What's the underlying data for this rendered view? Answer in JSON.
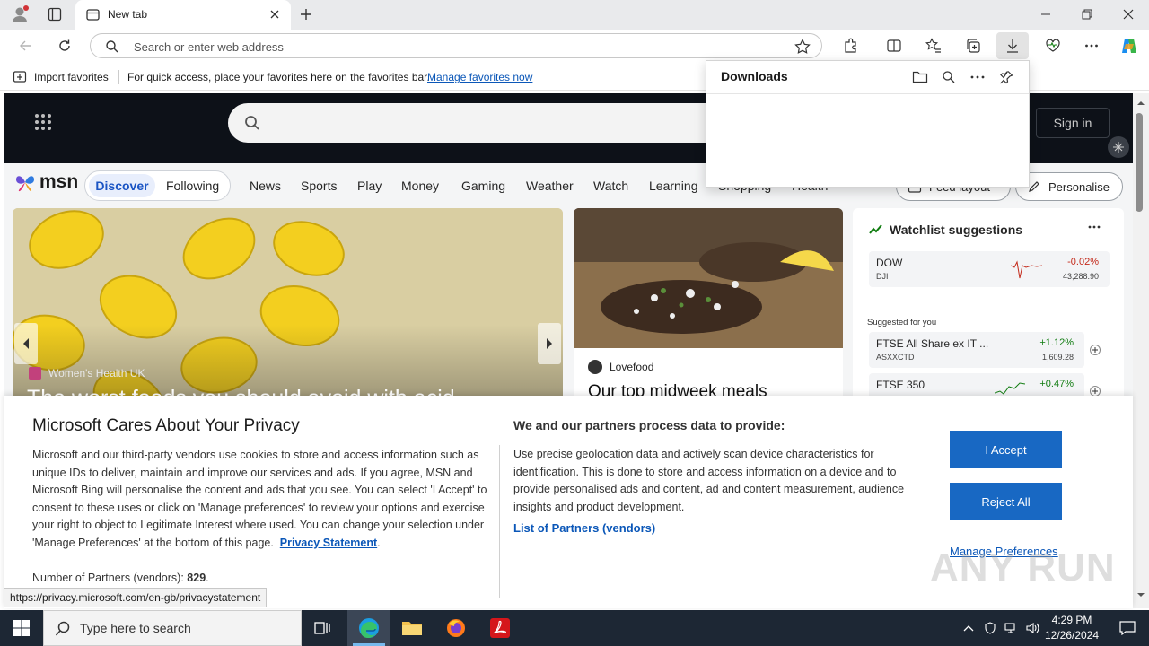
{
  "browser": {
    "tab_title": "New tab",
    "omnibox_placeholder": "Search or enter web address"
  },
  "favorites_bar": {
    "import_label": "Import favorites",
    "hint": "For quick access, place your favorites here on the favorites bar.",
    "manage_link": "Manage favorites now"
  },
  "downloads": {
    "title": "Downloads"
  },
  "msn": {
    "logo": "msn",
    "sign_in": "Sign in",
    "tabs": [
      "Discover",
      "Following"
    ],
    "nav": [
      "News",
      "Sports",
      "Play",
      "Money",
      "Gaming",
      "Weather",
      "Watch",
      "Learning",
      "Shopping",
      "Health"
    ],
    "feed_layout": "Feed layout",
    "personalise": "Personalise",
    "hero": {
      "source": "Women's Health UK",
      "headline": "The worst foods you should avoid with acid"
    },
    "food": {
      "source": "Lovefood",
      "headline": "Our top midweek meals"
    },
    "watchlist": {
      "title": "Watchlist suggestions",
      "top": {
        "symbol": "DOW",
        "exchange": "DJI",
        "change": "-0.02%",
        "value": "43,288.90"
      },
      "suggested_label": "Suggested for you",
      "items": [
        {
          "symbol": "FTSE All Share ex IT ...",
          "exchange": "ASXXCTD",
          "change": "+1.12%",
          "value": "1,609.28"
        },
        {
          "symbol": "FTSE 350",
          "exchange": "",
          "change": "+0.47%",
          "value": ""
        }
      ]
    }
  },
  "privacy": {
    "title": "Microsoft Cares About Your Privacy",
    "body": "Microsoft and our third-party vendors use cookies to store and access information such as unique IDs to deliver, maintain and improve our services and ads. If you agree, MSN and Microsoft Bing will personalise the content and ads that you see. You can select 'I Accept' to consent to these uses or click on 'Manage preferences' to review your options and exercise your right to object to Legitimate Interest where used.  You can change your selection under 'Manage Preferences' at the bottom of this page.",
    "privacy_link": "Privacy Statement",
    "partners_count_label": "Number of Partners (vendors):",
    "partners_count": "829",
    "title2": "We and our partners process data to provide:",
    "body2": "Use precise geolocation data and actively scan device characteristics for identification. This is done to store and access information on a device and to provide personalised ads and content, ad and content measurement, audience insights and product development.",
    "partners_link": "List of Partners (vendors)",
    "accept": "I Accept",
    "reject": "Reject All",
    "manage": "Manage Preferences"
  },
  "status_url": "https://privacy.microsoft.com/en-gb/privacystatement",
  "watermark": "ANY RUN",
  "taskbar": {
    "search_placeholder": "Type here to search",
    "time": "4:29 PM",
    "date": "12/26/2024"
  }
}
